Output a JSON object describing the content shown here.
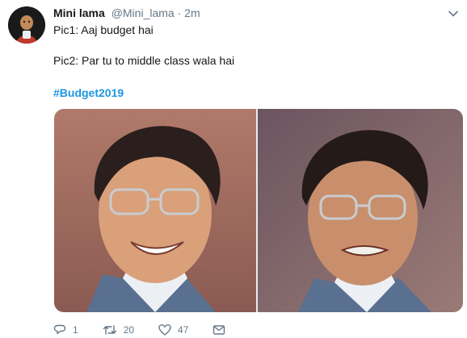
{
  "author": {
    "display_name": "Mini lama",
    "handle": "@Mini_lama",
    "separator": "·",
    "time": "2m"
  },
  "tweet": {
    "line1": "Pic1: Aaj budget hai",
    "line2": "Pic2: Par tu to middle class wala hai",
    "hashtag": "#Budget2019"
  },
  "actions": {
    "reply_count": "1",
    "retweet_count": "20",
    "like_count": "47"
  },
  "icons": {
    "caret": "chevron-down-icon",
    "reply": "reply-icon",
    "retweet": "retweet-icon",
    "like": "heart-icon",
    "message": "envelope-icon"
  },
  "colors": {
    "link": "#1b95e0",
    "muted": "#657786",
    "text": "#14171a"
  }
}
